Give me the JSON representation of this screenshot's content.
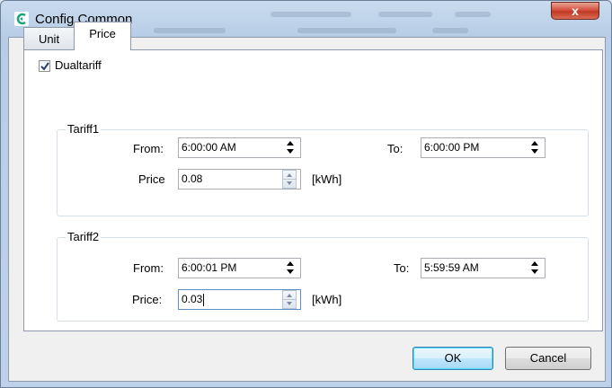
{
  "window": {
    "title": "Config Common",
    "close_label": "x"
  },
  "tabs": [
    {
      "label": "Unit",
      "active": false
    },
    {
      "label": "Price",
      "active": true
    }
  ],
  "dualtariff": {
    "label": "Dualtariff",
    "checked": true
  },
  "tariff1": {
    "legend": "Tariff1",
    "from_label": "From:",
    "from_value": "6:00:00 AM",
    "to_label": "To:",
    "to_value": "6:00:00 PM",
    "price_label": "Price",
    "price_value": "0.08",
    "unit": "[kWh]"
  },
  "tariff2": {
    "legend": "Tariff2",
    "from_label": "From:",
    "from_value": "6:00:01 PM",
    "to_label": "To:",
    "to_value": "5:59:59 AM",
    "price_label": "Price:",
    "price_value": "0.03",
    "unit": "[kWh]"
  },
  "buttons": {
    "ok": "OK",
    "cancel": "Cancel"
  },
  "colors": {
    "title_bar": "#bdd2ea",
    "close_button": "#c13a24",
    "panel": "#ffffff",
    "ok_focus": "#3c7fb1"
  }
}
